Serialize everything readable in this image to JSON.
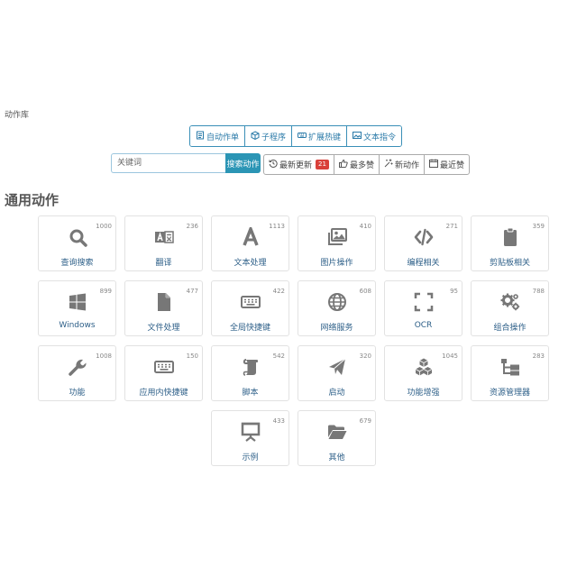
{
  "breadcrumb": "动作库",
  "type_tabs": [
    {
      "label": "自动作单",
      "icon": "document-icon"
    },
    {
      "label": "子程序",
      "icon": "cube-icon"
    },
    {
      "label": "扩展热键",
      "icon": "keyboard-icon"
    },
    {
      "label": "文本指令",
      "icon": "image-icon"
    }
  ],
  "search": {
    "placeholder": "关键词",
    "button_label": "搜索动作"
  },
  "sort_tabs": [
    {
      "label": "最新更新",
      "icon": "history-icon",
      "badge": "21"
    },
    {
      "label": "最多赞",
      "icon": "thumbs-up-icon"
    },
    {
      "label": "新动作",
      "icon": "sparkle-icon"
    },
    {
      "label": "最近赞",
      "icon": "calendar-icon"
    }
  ],
  "section_title": "通用动作",
  "cards": [
    {
      "label": "查询搜索",
      "count": "1000",
      "icon": "search"
    },
    {
      "label": "翻译",
      "count": "236",
      "icon": "translate"
    },
    {
      "label": "文本处理",
      "count": "1113",
      "icon": "font"
    },
    {
      "label": "图片操作",
      "count": "410",
      "icon": "images"
    },
    {
      "label": "编程相关",
      "count": "271",
      "icon": "code"
    },
    {
      "label": "剪贴板相关",
      "count": "359",
      "icon": "clipboard"
    },
    {
      "label": "Windows",
      "count": "899",
      "icon": "windows"
    },
    {
      "label": "文件处理",
      "count": "477",
      "icon": "file"
    },
    {
      "label": "全局快捷键",
      "count": "422",
      "icon": "keyboard"
    },
    {
      "label": "网络服务",
      "count": "608",
      "icon": "globe"
    },
    {
      "label": "OCR",
      "count": "95",
      "icon": "ocr"
    },
    {
      "label": "组合操作",
      "count": "788",
      "icon": "gears"
    },
    {
      "label": "功能",
      "count": "1008",
      "icon": "wrench"
    },
    {
      "label": "应用内快捷键",
      "count": "150",
      "icon": "keyboard"
    },
    {
      "label": "脚本",
      "count": "542",
      "icon": "scroll"
    },
    {
      "label": "启动",
      "count": "320",
      "icon": "paper-plane"
    },
    {
      "label": "功能增强",
      "count": "1045",
      "icon": "cubes"
    },
    {
      "label": "资源管理器",
      "count": "283",
      "icon": "sitemap"
    },
    {
      "label": "示例",
      "count": "433",
      "icon": "presentation"
    },
    {
      "label": "其他",
      "count": "679",
      "icon": "folder-open"
    }
  ],
  "colors": {
    "accent": "#2b95b5",
    "link": "#2d5f88",
    "icon": "#777777",
    "badge": "#d9403a"
  }
}
